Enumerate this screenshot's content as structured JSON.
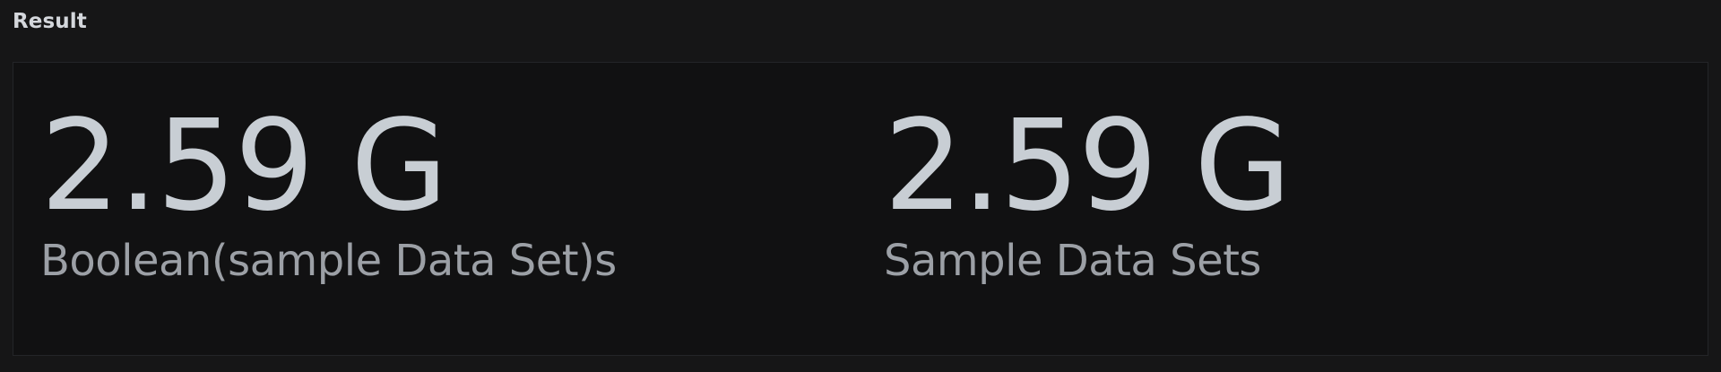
{
  "panel": {
    "title": "Result"
  },
  "stats": [
    {
      "value": "2.59 G",
      "label": "Boolean(sample Data Set)s"
    },
    {
      "value": "2.59 G",
      "label": "Sample Data Sets"
    }
  ],
  "colors": {
    "page_background": "#161617",
    "panel_background": "#111112",
    "value_text": "#c8ced4",
    "label_text": "#9ca0a6",
    "title_text": "#d4d7dc"
  }
}
